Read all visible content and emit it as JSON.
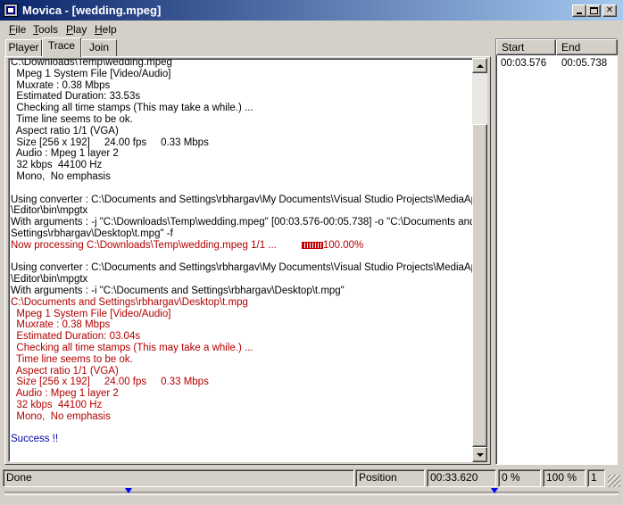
{
  "window": {
    "title": "Movica - [wedding.mpeg]"
  },
  "menu": {
    "file": {
      "underlined": "F",
      "rest": "ile"
    },
    "tools": {
      "underlined": "T",
      "rest": "ools"
    },
    "play": {
      "underlined": "P",
      "rest": "lay"
    },
    "help": {
      "underlined": "H",
      "rest": "elp"
    }
  },
  "tabs": {
    "player": "Player",
    "trace": "Trace",
    "join": "Join",
    "active": "Trace"
  },
  "trace": {
    "lines": [
      {
        "text": "C:\\Downloads\\Temp\\wedding.mpeg",
        "color": "black"
      },
      {
        "text": "  Mpeg 1 System File [Video/Audio]",
        "color": "black"
      },
      {
        "text": "  Muxrate : 0.38 Mbps",
        "color": "black"
      },
      {
        "text": "  Estimated Duration: 33.53s",
        "color": "black"
      },
      {
        "text": "  Checking all time stamps (This may take a while.) ...",
        "color": "black"
      },
      {
        "text": "  Time line seems to be ok.",
        "color": "black"
      },
      {
        "text": "  Aspect ratio 1/1 (VGA)",
        "color": "black"
      },
      {
        "text": "  Size [256 x 192]     24.00 fps     0.33 Mbps",
        "color": "black"
      },
      {
        "text": "  Audio : Mpeg 1 layer 2",
        "color": "black"
      },
      {
        "text": "  32 kbps  44100 Hz",
        "color": "black"
      },
      {
        "text": "  Mono,  No emphasis",
        "color": "black"
      },
      {
        "text": "",
        "color": "black"
      },
      {
        "text": "Using converter : C:\\Documents and Settings\\rbhargav\\My Documents\\Visual Studio Projects\\MediaApp",
        "color": "black"
      },
      {
        "text": "\\Editor\\bin\\mpgtx",
        "color": "black"
      },
      {
        "text": "With arguments : -j \"C:\\Downloads\\Temp\\wedding.mpeg\" [00:03.576-00:05.738] -o \"C:\\Documents and",
        "color": "black"
      },
      {
        "text": "Settings\\rbhargav\\Desktop\\t.mpg\" -f",
        "color": "black"
      },
      {
        "text": "Now processing C:\\Downloads\\Temp\\wedding.mpeg 1/1 ...",
        "color": "red",
        "progress": "100.00%"
      },
      {
        "text": "",
        "color": "black"
      },
      {
        "text": "Using converter : C:\\Documents and Settings\\rbhargav\\My Documents\\Visual Studio Projects\\MediaApp",
        "color": "black"
      },
      {
        "text": "\\Editor\\bin\\mpgtx",
        "color": "black"
      },
      {
        "text": "With arguments : -i \"C:\\Documents and Settings\\rbhargav\\Desktop\\t.mpg\"",
        "color": "black"
      },
      {
        "text": "C:\\Documents and Settings\\rbhargav\\Desktop\\t.mpg",
        "color": "red"
      },
      {
        "text": "  Mpeg 1 System File [Video/Audio]",
        "color": "red"
      },
      {
        "text": "  Muxrate : 0.38 Mbps",
        "color": "red"
      },
      {
        "text": "  Estimated Duration: 03.04s",
        "color": "red"
      },
      {
        "text": "  Checking all time stamps (This may take a while.) ...",
        "color": "red"
      },
      {
        "text": "  Time line seems to be ok.",
        "color": "red"
      },
      {
        "text": "  Aspect ratio 1/1 (VGA)",
        "color": "red"
      },
      {
        "text": "  Size [256 x 192]     24.00 fps     0.33 Mbps",
        "color": "red"
      },
      {
        "text": "  Audio : Mpeg 1 layer 2",
        "color": "red"
      },
      {
        "text": "  32 kbps  44100 Hz",
        "color": "red"
      },
      {
        "text": "  Mono,  No emphasis",
        "color": "red"
      },
      {
        "text": "",
        "color": "black"
      },
      {
        "text": "Success !!",
        "color": "blue"
      }
    ]
  },
  "segments": {
    "columns": {
      "start": "Start",
      "end": "End"
    },
    "rows": [
      {
        "start": "00:03.576",
        "end": "00:05.738"
      }
    ]
  },
  "statusbar": {
    "status": "Done",
    "position_label": "Position",
    "position_value": "00:33.620",
    "percent_1": "0 %",
    "percent_2": "100 %",
    "count": "1"
  },
  "colors": {
    "titlebar_start": "#0a246a",
    "titlebar_end": "#a6caf0",
    "trace_red": "#b30000",
    "trace_blue": "#0000a8",
    "timeline_marker": "#0000ff"
  }
}
